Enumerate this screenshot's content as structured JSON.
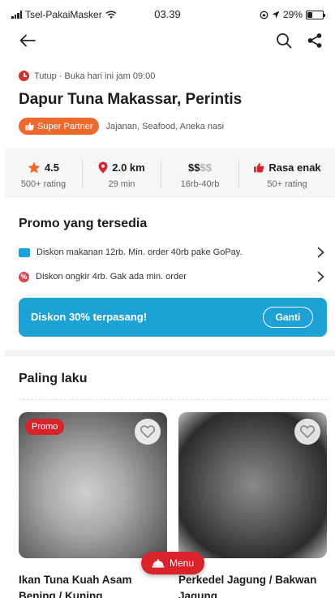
{
  "status_bar": {
    "carrier": "Tsel-PakaiMasker",
    "time": "03.39",
    "battery": "29%",
    "battery_level": 0.29
  },
  "topbar": {
    "icons": [
      "back-arrow-icon",
      "search-icon",
      "share-icon"
    ]
  },
  "restaurant": {
    "hours": "Tutup · Buka hari ini jam 09:00",
    "name": "Dapur Tuna Makassar, Perintis",
    "badge": "Super Partner",
    "cuisines": "Jajanan, Seafood, Aneka nasi"
  },
  "stats": {
    "rating": {
      "value": "4.5",
      "sub": "500+ rating"
    },
    "distance": {
      "value": "2.0 km",
      "sub": "29 min"
    },
    "price": {
      "value_active": "$$",
      "value_inactive": "$$",
      "sub": "16rb-40rb"
    },
    "taste": {
      "value": "Rasa enak",
      "sub": "50+ rating"
    }
  },
  "promo": {
    "title": "Promo yang tersedia",
    "items": [
      {
        "text": "Diskon makanan 12rb. Min. order 40rb pake GoPay."
      },
      {
        "text": "Diskon ongkir 4rb. Gak ada min. order"
      }
    ],
    "banner_text": "Diskon 30% terpasang!",
    "banner_button": "Ganti"
  },
  "bestseller": {
    "title": "Paling laku",
    "items": [
      {
        "tag": "Promo",
        "name": "Ikan Tuna Kuah Asam Bening / Kuning"
      },
      {
        "tag": "",
        "name": "Perkedel Jagung / Bakwan Jagung"
      }
    ]
  },
  "menu_button": "Menu",
  "colors": {
    "accent_orange": "#ee6a2c",
    "banner_blue": "#1ea2d6",
    "red": "#d8232a"
  }
}
